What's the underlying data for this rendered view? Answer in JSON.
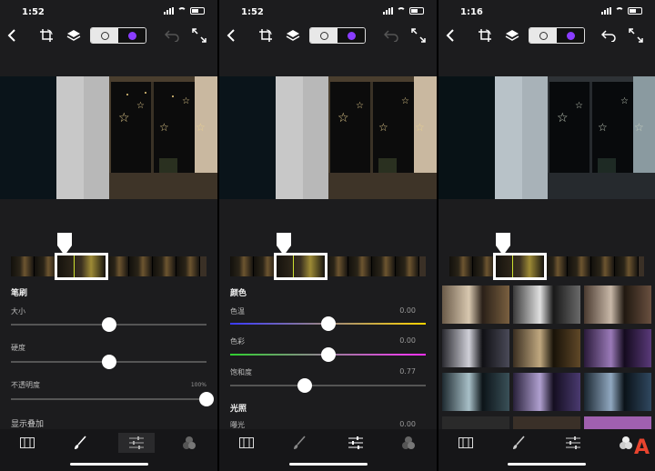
{
  "panels": [
    {
      "time": "1:52"
    },
    {
      "time": "1:52"
    },
    {
      "time": "1:16"
    }
  ],
  "brush": {
    "section": "笔刷",
    "size_label": "大小",
    "size_value": 0.5,
    "hardness_label": "硬度",
    "hardness_value": 0.5,
    "opacity_label": "不透明度",
    "opacity_text": "100%",
    "opacity_value": 1.0,
    "overlay_label": "显示叠加"
  },
  "color": {
    "section": "颜色",
    "temp_label": "色温",
    "temp_text": "0.00",
    "temp_value": 0.5,
    "tint_label": "色彩",
    "tint_text": "0.00",
    "tint_value": 0.5,
    "sat_label": "饱和度",
    "sat_text": "0.77",
    "sat_value": 0.38,
    "light_section": "光照",
    "exposure_label": "曝光",
    "exposure_text": "0.00"
  },
  "colors": {
    "accent": "#8a3cff",
    "panel_bg": "#1c1c1e",
    "watermark": "#e8442e"
  },
  "icons": [
    "back-arrow-icon",
    "crop-rotate-icon",
    "layers-icon",
    "undo-icon",
    "expand-icon",
    "filmstrip-icon",
    "brush-icon",
    "sliders-icon",
    "color-circles-icon"
  ],
  "watermark": "A"
}
